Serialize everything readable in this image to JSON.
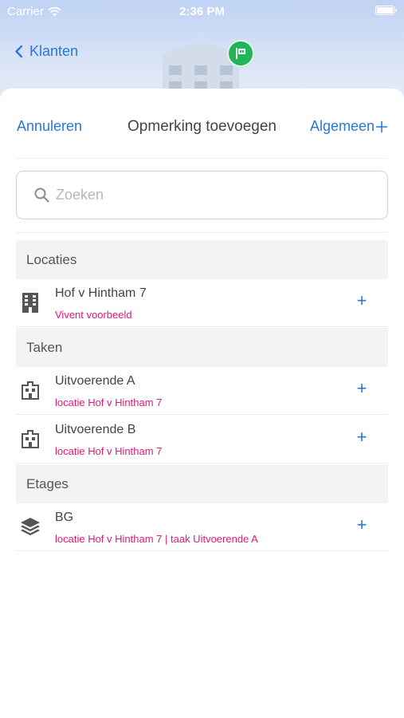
{
  "status_bar": {
    "carrier": "Carrier",
    "time": "2:36 PM"
  },
  "nav": {
    "back_label": "Klanten"
  },
  "sheet": {
    "cancel_label": "Annuleren",
    "title": "Opmerking toevoegen",
    "general_label": "Algemeen"
  },
  "search": {
    "placeholder": "Zoeken"
  },
  "sections": [
    {
      "header": "Locaties",
      "rows": [
        {
          "icon": "building-icon",
          "title": "Hof v Hintham 7",
          "subtitle": "Vivent voorbeeld"
        }
      ]
    },
    {
      "header": "Taken",
      "rows": [
        {
          "icon": "task-building-icon",
          "title": "Uitvoerende A",
          "subtitle": "locatie Hof v Hintham 7"
        },
        {
          "icon": "task-building-icon",
          "title": "Uitvoerende B",
          "subtitle": "locatie Hof v Hintham 7"
        }
      ]
    },
    {
      "header": "Etages",
      "rows": [
        {
          "icon": "layers-icon",
          "title": "BG",
          "subtitle": "locatie Hof v Hintham 7 | taak Uitvoerende A"
        }
      ]
    }
  ],
  "colors": {
    "accent": "#2a78d6",
    "subtitle": "#e0187c",
    "badge": "#22b45a",
    "section_bg": "#f2f3f5"
  }
}
